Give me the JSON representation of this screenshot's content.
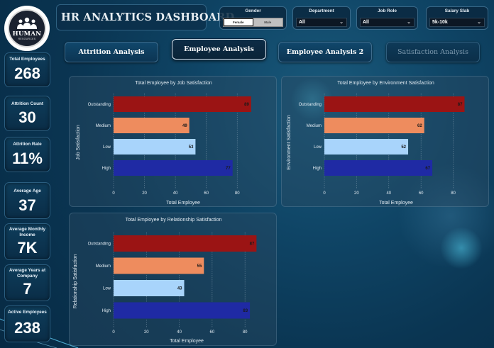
{
  "header": {
    "title": "HR ANALYTICS DASHBOARD"
  },
  "logo": {
    "word": "HUMAN",
    "sub": "RESOURCES",
    "icon": "people-group-icon"
  },
  "filters": {
    "gender": {
      "label": "Gender",
      "options": [
        "Female",
        "Male"
      ],
      "selected": "Female"
    },
    "department": {
      "label": "Department",
      "value": "All"
    },
    "job_role": {
      "label": "Job Role",
      "value": "All"
    },
    "salary_slab": {
      "label": "Salary Slab",
      "value": "5k-10k"
    }
  },
  "nav": {
    "attrition": "Attrition Analysis",
    "employee": "Employee Analysis",
    "employee2": "Employee Analysis 2",
    "satisfaction": "Satisfaction Analysis",
    "active": "Employee Analysis"
  },
  "kpis": [
    {
      "label": "Total Employees",
      "value": "268"
    },
    {
      "label": "Attrition Count",
      "value": "30"
    },
    {
      "label": "Attrition Rate",
      "value": "11%"
    },
    {
      "label": "Average Age",
      "value": "37"
    },
    {
      "label": "Average Monthly Income",
      "value": "7K"
    },
    {
      "label": "Average Years at Company",
      "value": "7"
    },
    {
      "label": "Active Employees",
      "value": "238"
    }
  ],
  "colors": {
    "outstanding": "#9b1414",
    "medium": "#ee8c5e",
    "low": "#a8d4fb",
    "high": "#1f2aa4"
  },
  "chart_data": [
    {
      "type": "bar",
      "orientation": "horizontal",
      "title": "Total Employee by Job Satisfaction",
      "xlabel": "Total Employee",
      "ylabel": "Job Satisfaction",
      "categories": [
        "Outstanding",
        "Medium",
        "Low",
        "High"
      ],
      "values": [
        89,
        49,
        53,
        77
      ],
      "xticks": [
        0,
        20,
        40,
        60,
        80
      ],
      "xlim": [
        0,
        90
      ],
      "grid": true
    },
    {
      "type": "bar",
      "orientation": "horizontal",
      "title": "Total Employee by Environment Satisfaction",
      "xlabel": "Total Employee",
      "ylabel": "Environment Satisfaction",
      "categories": [
        "Outstanding",
        "Medium",
        "Low",
        "High"
      ],
      "values": [
        87,
        62,
        52,
        67
      ],
      "xticks": [
        0,
        20,
        40,
        60,
        80
      ],
      "xlim": [
        0,
        89
      ],
      "grid": true
    },
    {
      "type": "bar",
      "orientation": "horizontal",
      "title": "Total Employee by Relationship Satisfaction",
      "xlabel": "Total Employee",
      "ylabel": "Relationship Satisfaction",
      "categories": [
        "Outstanding",
        "Medium",
        "Low",
        "High"
      ],
      "values": [
        87,
        55,
        43,
        83
      ],
      "xticks": [
        0,
        20,
        40,
        60,
        80
      ],
      "xlim": [
        0,
        89
      ],
      "grid": true
    }
  ]
}
